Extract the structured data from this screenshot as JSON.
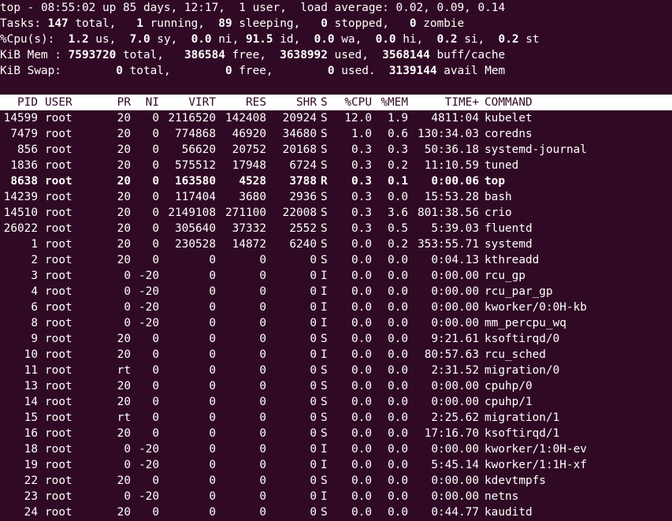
{
  "summary": [
    {
      "segments": [
        {
          "t": "top - 08:55:02 up 85 days, 12:17,  1 user,  load average: 0.02, 0.09, 0.14",
          "b": false
        }
      ]
    },
    {
      "segments": [
        {
          "t": "Tasks: ",
          "b": false
        },
        {
          "t": "147",
          "b": true
        },
        {
          "t": " total,   ",
          "b": false
        },
        {
          "t": "1",
          "b": true
        },
        {
          "t": " running,  ",
          "b": false
        },
        {
          "t": "89",
          "b": true
        },
        {
          "t": " sleeping,   ",
          "b": false
        },
        {
          "t": "0",
          "b": true
        },
        {
          "t": " stopped,   ",
          "b": false
        },
        {
          "t": "0",
          "b": true
        },
        {
          "t": " zombie",
          "b": false
        }
      ]
    },
    {
      "segments": [
        {
          "t": "%Cpu(s):  ",
          "b": false
        },
        {
          "t": "1.2",
          "b": true
        },
        {
          "t": " us,  ",
          "b": false
        },
        {
          "t": "7.0",
          "b": true
        },
        {
          "t": " sy,  ",
          "b": false
        },
        {
          "t": "0.0",
          "b": true
        },
        {
          "t": " ni, ",
          "b": false
        },
        {
          "t": "91.5",
          "b": true
        },
        {
          "t": " id,  ",
          "b": false
        },
        {
          "t": "0.0",
          "b": true
        },
        {
          "t": " wa,  ",
          "b": false
        },
        {
          "t": "0.0",
          "b": true
        },
        {
          "t": " hi,  ",
          "b": false
        },
        {
          "t": "0.2",
          "b": true
        },
        {
          "t": " si,  ",
          "b": false
        },
        {
          "t": "0.2",
          "b": true
        },
        {
          "t": " st",
          "b": false
        }
      ]
    },
    {
      "segments": [
        {
          "t": "KiB Mem : ",
          "b": false
        },
        {
          "t": "7593720",
          "b": true
        },
        {
          "t": " total,   ",
          "b": false
        },
        {
          "t": "386584",
          "b": true
        },
        {
          "t": " free,  ",
          "b": false
        },
        {
          "t": "3638992",
          "b": true
        },
        {
          "t": " used,  ",
          "b": false
        },
        {
          "t": "3568144",
          "b": true
        },
        {
          "t": " buff/cache",
          "b": false
        }
      ]
    },
    {
      "segments": [
        {
          "t": "KiB Swap:        ",
          "b": false
        },
        {
          "t": "0",
          "b": true
        },
        {
          "t": " total,        ",
          "b": false
        },
        {
          "t": "0",
          "b": true
        },
        {
          "t": " free,        ",
          "b": false
        },
        {
          "t": "0",
          "b": true
        },
        {
          "t": " used.  ",
          "b": false
        },
        {
          "t": "3139144",
          "b": true
        },
        {
          "t": " avail Mem",
          "b": false
        }
      ]
    }
  ],
  "columns": [
    "PID",
    "USER",
    "PR",
    "NI",
    "VIRT",
    "RES",
    "SHR",
    "S",
    "%CPU",
    "%MEM",
    "TIME+",
    "COMMAND"
  ],
  "processes": [
    {
      "pid": "14599",
      "user": "root",
      "pr": "20",
      "ni": "0",
      "virt": "2116520",
      "res": "142408",
      "shr": "20924",
      "s": "S",
      "cpu": "12.0",
      "mem": "1.9",
      "time": "4811:04",
      "cmd": "kubelet",
      "bold": false
    },
    {
      "pid": "7479",
      "user": "root",
      "pr": "20",
      "ni": "0",
      "virt": "774868",
      "res": "46920",
      "shr": "34680",
      "s": "S",
      "cpu": "1.0",
      "mem": "0.6",
      "time": "130:34.03",
      "cmd": "coredns",
      "bold": false
    },
    {
      "pid": "856",
      "user": "root",
      "pr": "20",
      "ni": "0",
      "virt": "56620",
      "res": "20752",
      "shr": "20168",
      "s": "S",
      "cpu": "0.3",
      "mem": "0.3",
      "time": "50:36.18",
      "cmd": "systemd-journal",
      "bold": false
    },
    {
      "pid": "1836",
      "user": "root",
      "pr": "20",
      "ni": "0",
      "virt": "575512",
      "res": "17948",
      "shr": "6724",
      "s": "S",
      "cpu": "0.3",
      "mem": "0.2",
      "time": "11:10.59",
      "cmd": "tuned",
      "bold": false
    },
    {
      "pid": "8638",
      "user": "root",
      "pr": "20",
      "ni": "0",
      "virt": "163580",
      "res": "4528",
      "shr": "3788",
      "s": "R",
      "cpu": "0.3",
      "mem": "0.1",
      "time": "0:00.06",
      "cmd": "top",
      "bold": true
    },
    {
      "pid": "14239",
      "user": "root",
      "pr": "20",
      "ni": "0",
      "virt": "117404",
      "res": "3680",
      "shr": "2936",
      "s": "S",
      "cpu": "0.3",
      "mem": "0.0",
      "time": "15:53.28",
      "cmd": "bash",
      "bold": false
    },
    {
      "pid": "14510",
      "user": "root",
      "pr": "20",
      "ni": "0",
      "virt": "2149108",
      "res": "271100",
      "shr": "22008",
      "s": "S",
      "cpu": "0.3",
      "mem": "3.6",
      "time": "801:38.56",
      "cmd": "crio",
      "bold": false
    },
    {
      "pid": "26022",
      "user": "root",
      "pr": "20",
      "ni": "0",
      "virt": "305640",
      "res": "37332",
      "shr": "2552",
      "s": "S",
      "cpu": "0.3",
      "mem": "0.5",
      "time": "5:39.03",
      "cmd": "fluentd",
      "bold": false
    },
    {
      "pid": "1",
      "user": "root",
      "pr": "20",
      "ni": "0",
      "virt": "230528",
      "res": "14872",
      "shr": "6240",
      "s": "S",
      "cpu": "0.0",
      "mem": "0.2",
      "time": "353:55.71",
      "cmd": "systemd",
      "bold": false
    },
    {
      "pid": "2",
      "user": "root",
      "pr": "20",
      "ni": "0",
      "virt": "0",
      "res": "0",
      "shr": "0",
      "s": "S",
      "cpu": "0.0",
      "mem": "0.0",
      "time": "0:04.13",
      "cmd": "kthreadd",
      "bold": false
    },
    {
      "pid": "3",
      "user": "root",
      "pr": "0",
      "ni": "-20",
      "virt": "0",
      "res": "0",
      "shr": "0",
      "s": "I",
      "cpu": "0.0",
      "mem": "0.0",
      "time": "0:00.00",
      "cmd": "rcu_gp",
      "bold": false
    },
    {
      "pid": "4",
      "user": "root",
      "pr": "0",
      "ni": "-20",
      "virt": "0",
      "res": "0",
      "shr": "0",
      "s": "I",
      "cpu": "0.0",
      "mem": "0.0",
      "time": "0:00.00",
      "cmd": "rcu_par_gp",
      "bold": false
    },
    {
      "pid": "6",
      "user": "root",
      "pr": "0",
      "ni": "-20",
      "virt": "0",
      "res": "0",
      "shr": "0",
      "s": "I",
      "cpu": "0.0",
      "mem": "0.0",
      "time": "0:00.00",
      "cmd": "kworker/0:0H-kb",
      "bold": false
    },
    {
      "pid": "8",
      "user": "root",
      "pr": "0",
      "ni": "-20",
      "virt": "0",
      "res": "0",
      "shr": "0",
      "s": "I",
      "cpu": "0.0",
      "mem": "0.0",
      "time": "0:00.00",
      "cmd": "mm_percpu_wq",
      "bold": false
    },
    {
      "pid": "9",
      "user": "root",
      "pr": "20",
      "ni": "0",
      "virt": "0",
      "res": "0",
      "shr": "0",
      "s": "S",
      "cpu": "0.0",
      "mem": "0.0",
      "time": "9:21.61",
      "cmd": "ksoftirqd/0",
      "bold": false
    },
    {
      "pid": "10",
      "user": "root",
      "pr": "20",
      "ni": "0",
      "virt": "0",
      "res": "0",
      "shr": "0",
      "s": "I",
      "cpu": "0.0",
      "mem": "0.0",
      "time": "80:57.63",
      "cmd": "rcu_sched",
      "bold": false
    },
    {
      "pid": "11",
      "user": "root",
      "pr": "rt",
      "ni": "0",
      "virt": "0",
      "res": "0",
      "shr": "0",
      "s": "S",
      "cpu": "0.0",
      "mem": "0.0",
      "time": "2:31.52",
      "cmd": "migration/0",
      "bold": false
    },
    {
      "pid": "13",
      "user": "root",
      "pr": "20",
      "ni": "0",
      "virt": "0",
      "res": "0",
      "shr": "0",
      "s": "S",
      "cpu": "0.0",
      "mem": "0.0",
      "time": "0:00.00",
      "cmd": "cpuhp/0",
      "bold": false
    },
    {
      "pid": "14",
      "user": "root",
      "pr": "20",
      "ni": "0",
      "virt": "0",
      "res": "0",
      "shr": "0",
      "s": "S",
      "cpu": "0.0",
      "mem": "0.0",
      "time": "0:00.00",
      "cmd": "cpuhp/1",
      "bold": false
    },
    {
      "pid": "15",
      "user": "root",
      "pr": "rt",
      "ni": "0",
      "virt": "0",
      "res": "0",
      "shr": "0",
      "s": "S",
      "cpu": "0.0",
      "mem": "0.0",
      "time": "2:25.62",
      "cmd": "migration/1",
      "bold": false
    },
    {
      "pid": "16",
      "user": "root",
      "pr": "20",
      "ni": "0",
      "virt": "0",
      "res": "0",
      "shr": "0",
      "s": "S",
      "cpu": "0.0",
      "mem": "0.0",
      "time": "17:16.70",
      "cmd": "ksoftirqd/1",
      "bold": false
    },
    {
      "pid": "18",
      "user": "root",
      "pr": "0",
      "ni": "-20",
      "virt": "0",
      "res": "0",
      "shr": "0",
      "s": "I",
      "cpu": "0.0",
      "mem": "0.0",
      "time": "0:00.00",
      "cmd": "kworker/1:0H-ev",
      "bold": false
    },
    {
      "pid": "19",
      "user": "root",
      "pr": "0",
      "ni": "-20",
      "virt": "0",
      "res": "0",
      "shr": "0",
      "s": "I",
      "cpu": "0.0",
      "mem": "0.0",
      "time": "5:45.14",
      "cmd": "kworker/1:1H-xf",
      "bold": false
    },
    {
      "pid": "22",
      "user": "root",
      "pr": "20",
      "ni": "0",
      "virt": "0",
      "res": "0",
      "shr": "0",
      "s": "S",
      "cpu": "0.0",
      "mem": "0.0",
      "time": "0:00.00",
      "cmd": "kdevtmpfs",
      "bold": false
    },
    {
      "pid": "23",
      "user": "root",
      "pr": "0",
      "ni": "-20",
      "virt": "0",
      "res": "0",
      "shr": "0",
      "s": "I",
      "cpu": "0.0",
      "mem": "0.0",
      "time": "0:00.00",
      "cmd": "netns",
      "bold": false
    },
    {
      "pid": "24",
      "user": "root",
      "pr": "20",
      "ni": "0",
      "virt": "0",
      "res": "0",
      "shr": "0",
      "s": "S",
      "cpu": "0.0",
      "mem": "0.0",
      "time": "0:44.77",
      "cmd": "kauditd",
      "bold": false
    }
  ],
  "colors": {
    "background": "#300a24",
    "foreground": "#ffffff"
  }
}
